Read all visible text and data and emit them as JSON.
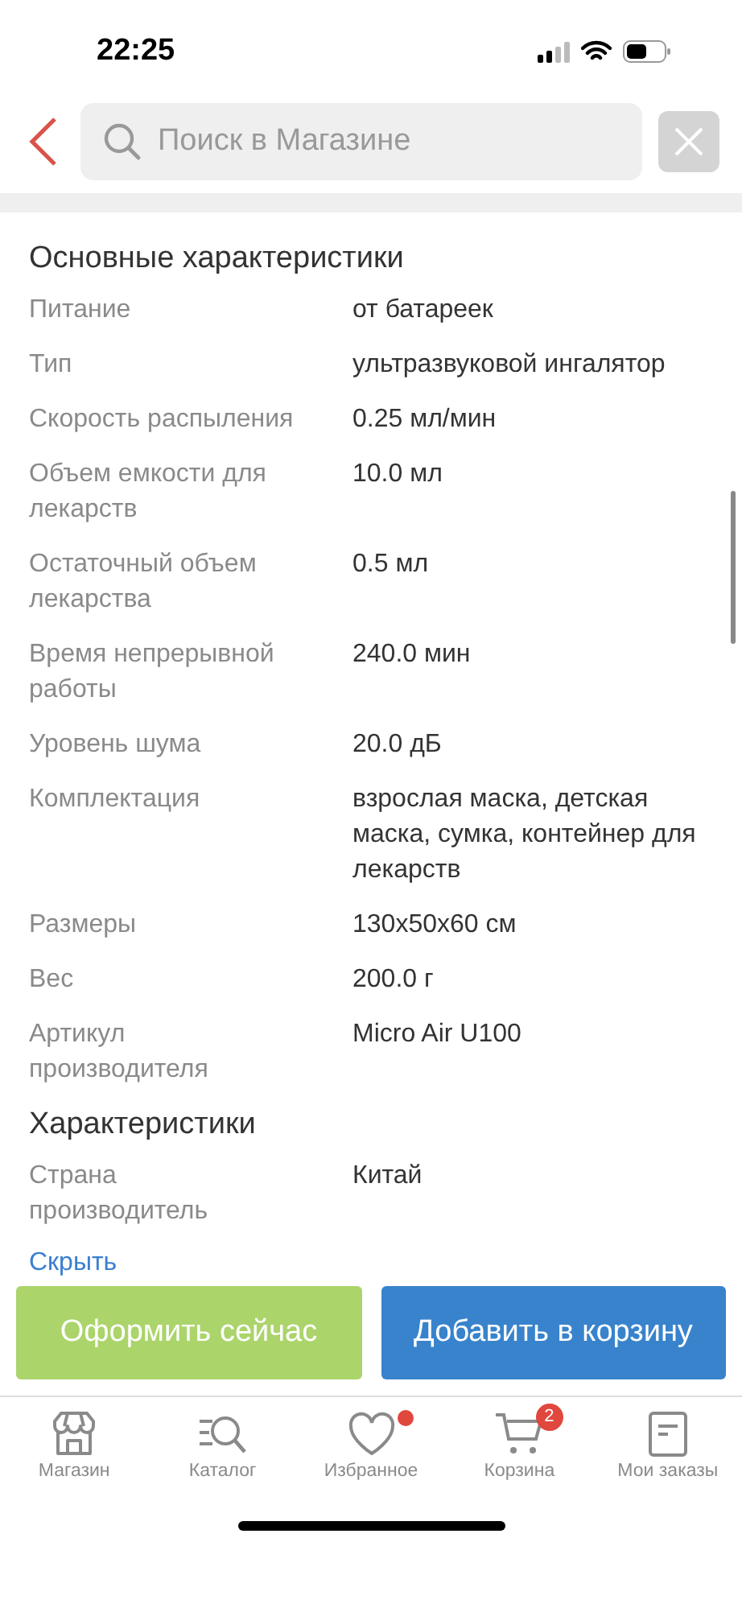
{
  "status_bar": {
    "time": "22:25"
  },
  "search": {
    "placeholder": "Поиск в Магазине"
  },
  "sections": [
    {
      "title": "Основные характеристики",
      "rows": [
        {
          "label": "Питание",
          "value": "от батареек"
        },
        {
          "label": "Тип",
          "value": "ультразвуковой ингалятор"
        },
        {
          "label": "Скорость распыления",
          "value": "0.25 мл/мин"
        },
        {
          "label": "Объем емкости для лекарств",
          "value": "10.0 мл"
        },
        {
          "label": "Остаточный объем лекарства",
          "value": "0.5 мл"
        },
        {
          "label": "Время непрерывной работы",
          "value": "240.0 мин"
        },
        {
          "label": "Уровень шума",
          "value": "20.0 дБ"
        },
        {
          "label": "Комплектация",
          "value": "взрослая маска, детская маска, сумка, контейнер для лекарств"
        },
        {
          "label": "Размеры",
          "value": "130х50х60 см"
        },
        {
          "label": "Вес",
          "value": "200.0 г"
        },
        {
          "label": "Артикул производителя",
          "value": "Micro Air U100"
        }
      ]
    },
    {
      "title": "Характеристики",
      "rows": [
        {
          "label": "Страна производитель",
          "value": "Китай"
        }
      ]
    }
  ],
  "hide_link": "Скрыть",
  "actions": [
    {
      "kind": "secondary",
      "label": "Оформить сейчас"
    },
    {
      "kind": "primary",
      "label": "Добавить в корзину"
    }
  ],
  "tab_bar": [
    {
      "label": "Магазин",
      "selected": false
    },
    {
      "label": "Каталог",
      "selected": false
    },
    {
      "label": "Избранное",
      "selected": false,
      "badge": {
        "kind": "dot"
      }
    },
    {
      "label": "Корзина",
      "selected": false,
      "badge": {
        "kind": "count",
        "text": "2"
      }
    },
    {
      "label": "Мои заказы",
      "selected": false
    }
  ]
}
